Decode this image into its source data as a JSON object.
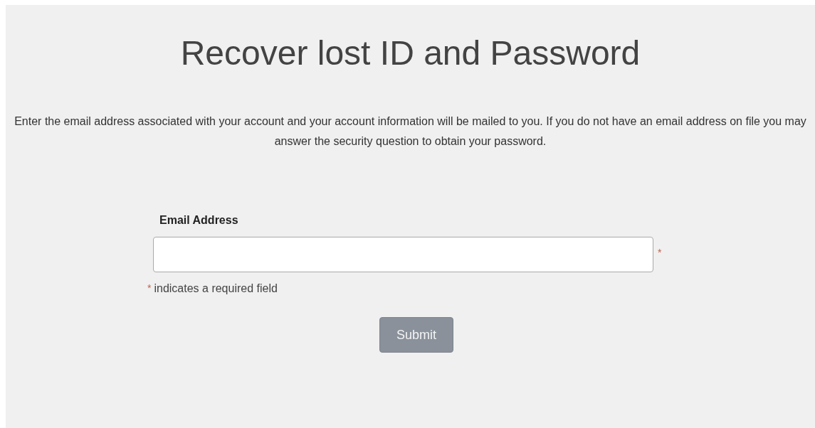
{
  "title": "Recover lost ID and Password",
  "intro": "Enter the email address associated with your account and your account information will be mailed to you. If you do not have an email address on file you may answer the security question to obtain your password.",
  "email_field": {
    "label": "Email Address",
    "required_marker": "*"
  },
  "required_note": {
    "marker": "*",
    "text": "indicates a required field"
  },
  "submit_button": {
    "label": "Submit",
    "disabled": true
  }
}
